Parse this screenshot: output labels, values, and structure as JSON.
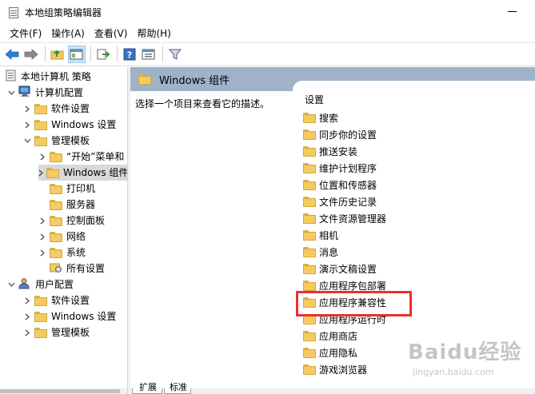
{
  "window": {
    "title": "本地组策略编辑器"
  },
  "menu": [
    "文件(F)",
    "操作(A)",
    "查看(V)",
    "帮助(H)"
  ],
  "toolbar": {
    "buttons": [
      "back-icon",
      "forward-icon",
      "up-folder-icon",
      "show-hide-tree-icon",
      "export-list-icon",
      "help-icon",
      "properties-icon",
      "filter-icon"
    ]
  },
  "tree": {
    "root": "本地计算机 策略",
    "computer_config": "计算机配置",
    "software_settings": "软件设置",
    "windows_settings": "Windows 设置",
    "admin_templates": "管理模板",
    "start_menu": "“开始”菜单和",
    "windows_components": "Windows 组件",
    "printers": "打印机",
    "server": "服务器",
    "control_panel": "控制面板",
    "network": "网络",
    "system": "系统",
    "all_settings": "所有设置",
    "user_config": "用户配置",
    "u_software_settings": "软件设置",
    "u_windows_settings": "Windows 设置",
    "u_admin_templates": "管理模板"
  },
  "right": {
    "header": "Windows 组件",
    "description": "选择一个项目来查看它的描述。",
    "list_header": "设置",
    "items": [
      "搜索",
      "同步你的设置",
      "推送安装",
      "维护计划程序",
      "位置和传感器",
      "文件历史记录",
      "文件资源管理器",
      "相机",
      "消息",
      "演示文稿设置",
      "应用程序包部署",
      "应用程序兼容性",
      "应用程序运行时",
      "应用商店",
      "应用隐私",
      "游戏浏览器"
    ]
  },
  "tabs": [
    "扩展",
    "标准"
  ],
  "colors": {
    "header_bg": "#9eb3c9",
    "highlight": "#e8312f",
    "folder": "#f3cb62"
  },
  "watermark": {
    "brand": "Baidu经验",
    "url": "jingyan.baidu.com"
  }
}
